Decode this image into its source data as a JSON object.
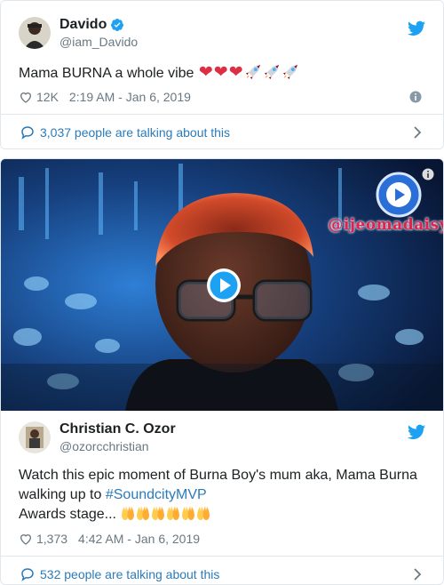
{
  "tweet1": {
    "display_name": "Davido",
    "handle": "@iam_Davido",
    "text": "Mama BURNA a whole vibe",
    "emojis": [
      "heart",
      "heart",
      "heart",
      "rocket",
      "rocket",
      "rocket"
    ],
    "likes": "12K",
    "timestamp": "2:19 AM - Jan 6, 2019",
    "talking": "3,037 people are talking about this"
  },
  "tweet2": {
    "display_name": "Christian C. Ozor",
    "handle": "@ozorcchristian",
    "text_line1": "Watch this epic moment of Burna Boy's mum aka, Mama Burna",
    "text_line2_prefix": "walking up to ",
    "hashtag": "#SoundcityMVP",
    "text_line3": "Awards stage...",
    "emojis": [
      "raised-hands",
      "raised-hands",
      "raised-hands",
      "raised-hands",
      "raised-hands",
      "raised-hands"
    ],
    "likes": "1,373",
    "timestamp": "4:42 AM - Jan 6, 2019",
    "talking": "532 people are talking about this",
    "media": {
      "watermark": "@ijeomadaisy"
    }
  },
  "colors": {
    "link": "#2b7bb9",
    "text": "#1c2022",
    "muted": "#697882",
    "border": "#e1e8ed",
    "twitter_blue": "#1da1f2",
    "heart_red": "#dd2e44"
  }
}
